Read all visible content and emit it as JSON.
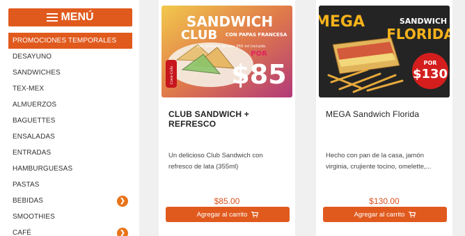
{
  "sidebar": {
    "title": "MENÚ",
    "items": [
      {
        "label": "PROMOCIONES TEMPORALES",
        "active": true,
        "expand": false
      },
      {
        "label": "DESAYUNO",
        "active": false,
        "expand": false
      },
      {
        "label": "SANDWICHES",
        "active": false,
        "expand": false
      },
      {
        "label": "TEX-MEX",
        "active": false,
        "expand": false
      },
      {
        "label": "ALMUERZOS",
        "active": false,
        "expand": false
      },
      {
        "label": "BAGUETTES",
        "active": false,
        "expand": false
      },
      {
        "label": "ENSALADAS",
        "active": false,
        "expand": false
      },
      {
        "label": "ENTRADAS",
        "active": false,
        "expand": false
      },
      {
        "label": "HAMBURGUESAS",
        "active": false,
        "expand": false
      },
      {
        "label": "PASTAS",
        "active": false,
        "expand": false
      },
      {
        "label": "BEBIDAS",
        "active": false,
        "expand": true
      },
      {
        "label": "SMOOTHIES",
        "active": false,
        "expand": false
      },
      {
        "label": "CAFÉ",
        "active": false,
        "expand": true
      }
    ]
  },
  "products": [
    {
      "image": {
        "line1": "SANDWICH",
        "line2": "CLUB",
        "tagline": "CON PAPAS FRANCESA",
        "subline": "con refresco de lata 355 ml incluido",
        "por": "POR",
        "price": "$85",
        "soda": "Coca-Cola"
      },
      "title": "CLUB SANDWICH + REFRESCO",
      "description": "Un delicioso Club Sandwich con refresco de lata (355ml)",
      "price": "$85.00",
      "button": "Agregar al carrito"
    },
    {
      "image": {
        "line1": "MEGA",
        "line2": "SANDWICH",
        "line3": "FLORIDA",
        "por": "POR",
        "price": "$130"
      },
      "title": "MEGA Sandwich Florida",
      "description": "Hecho con pan de la casa, jamón virginia, crujiente tocino, omelette,...",
      "price": "$130.00",
      "button": "Agregar al carrito"
    }
  ],
  "colors": {
    "accent": "#e05a1e",
    "price": "#d9531e"
  }
}
